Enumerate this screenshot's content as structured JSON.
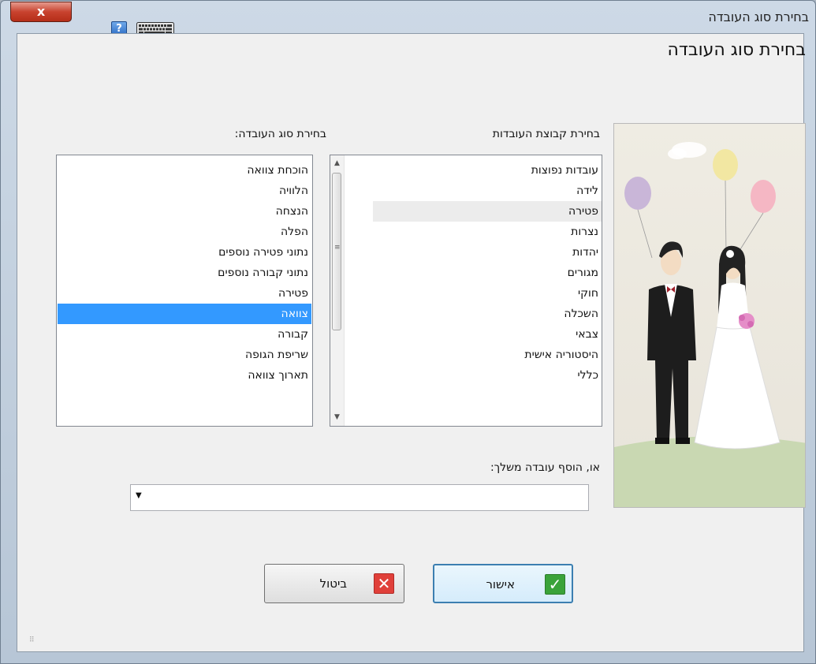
{
  "window": {
    "title": "בחירת סוג העובדה",
    "close_label": "x",
    "help_label": "?"
  },
  "heading": "בחירת סוג העובדה",
  "groups_label": "בחירת קבוצת העובדות",
  "types_label": "בחירת סוג העובדה:",
  "groups": [
    "עובדות נפוצות",
    "לידה",
    "פטירה",
    "נצרות",
    "יהדות",
    "מגורים",
    "חוקי",
    "השכלה",
    "צבאי",
    "היסטוריה אישית",
    "כללי"
  ],
  "hovered_group": "פטירה",
  "types": [
    "הוכחת צוואה",
    "הלוויה",
    "הנצחה",
    "הפלה",
    "נתוני פטירה נוספים",
    "נתוני קבורה נוספים",
    "פטירה",
    "צוואה",
    "קבורה",
    "שריפת הגופה",
    "תארוך צוואה"
  ],
  "selected_type": "צוואה",
  "custom_label": "או, הוסף עובדה משלך:",
  "custom_value": "",
  "ok_label": "אישור",
  "cancel_label": "ביטול",
  "colors": {
    "selection": "#3399ff",
    "ok_icon": "#3aa33a",
    "cancel_icon": "#e0403a"
  },
  "icons": {
    "ok": "checkmark-icon",
    "cancel": "x-icon",
    "help": "help-icon",
    "keyboard": "keyboard-icon"
  }
}
